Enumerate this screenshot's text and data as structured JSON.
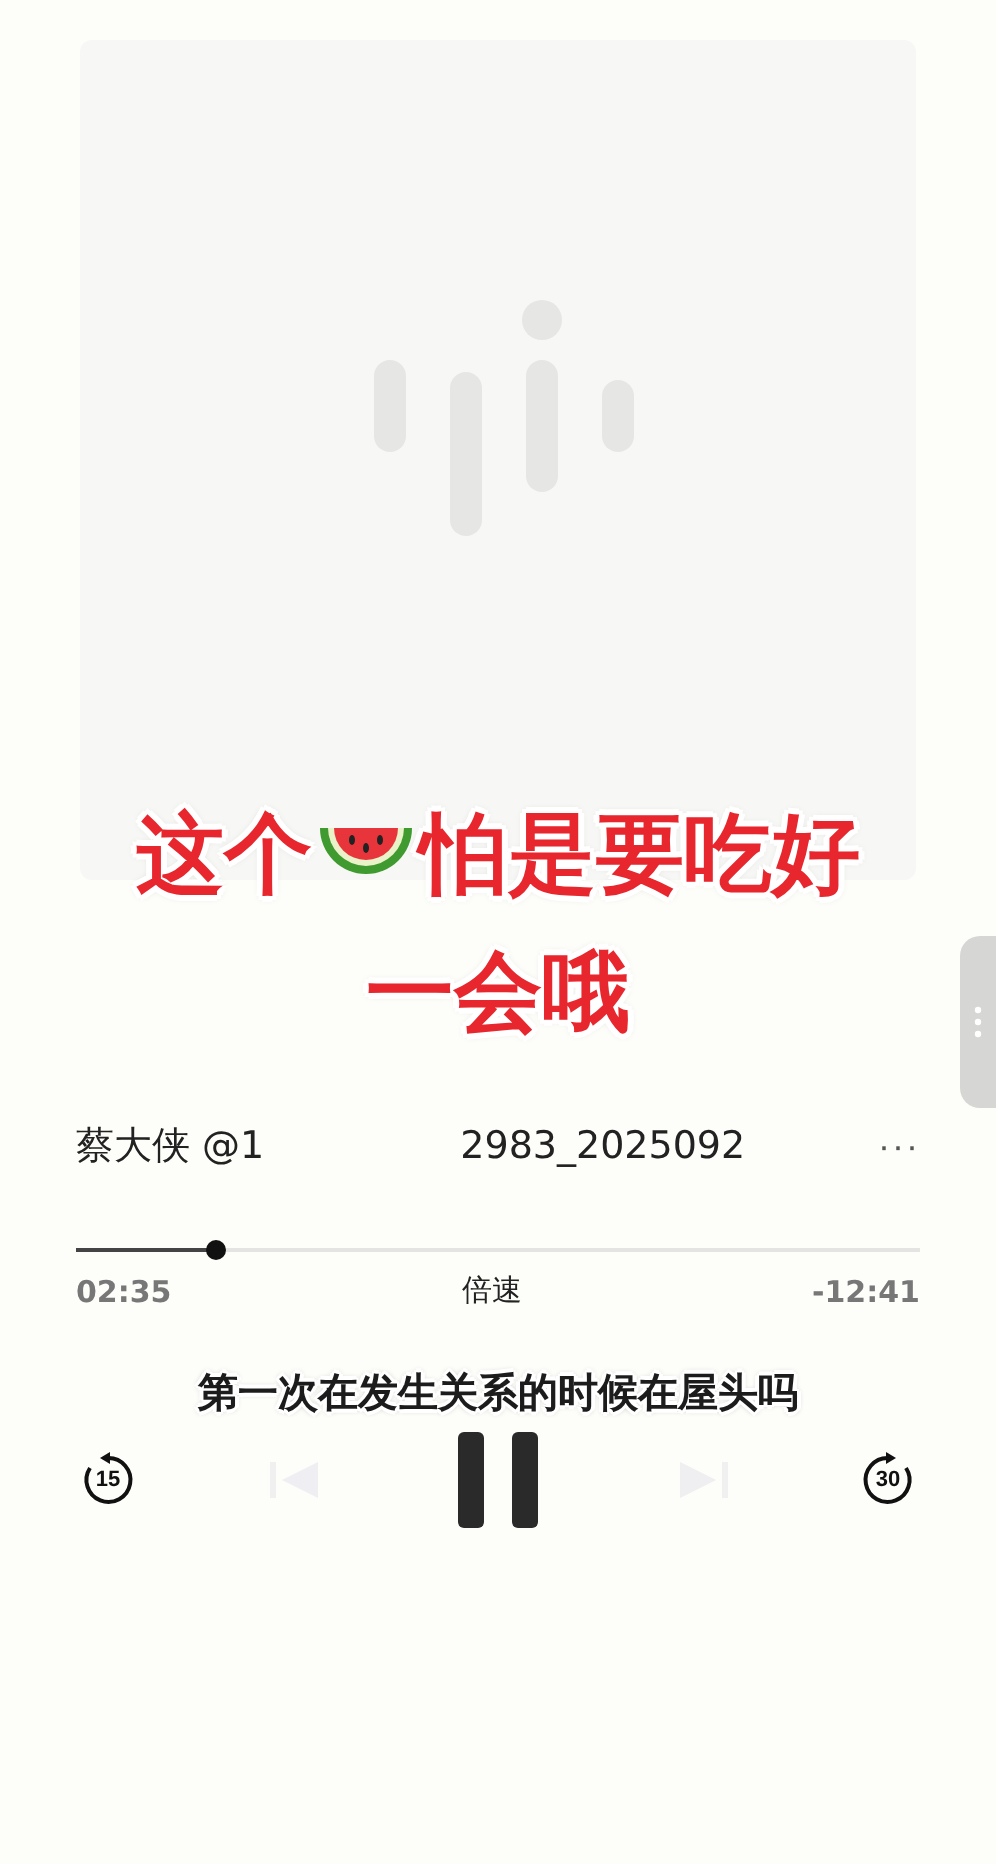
{
  "caption": {
    "before_icon": "这个",
    "after_icon": "怕是要吃好",
    "second_line": "一会哦"
  },
  "track": {
    "title_start": "蔡大侠 @1",
    "title_end": "2983_2025092",
    "more": "···"
  },
  "progress": {
    "level": 0.166,
    "elapsed": "02:35",
    "speed": "倍速",
    "remaining": "-12:41"
  },
  "subtitle": "第一次在发生关系的时候在屋头吗",
  "controls": {
    "back": "15",
    "forward": "30",
    "playing": true
  }
}
